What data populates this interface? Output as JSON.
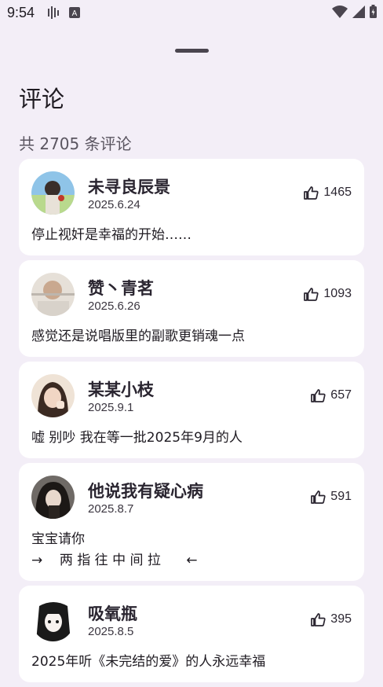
{
  "status_bar": {
    "time": "9:54"
  },
  "sheet": {
    "title": "评论",
    "count_text": "共 2705 条评论"
  },
  "comments": [
    {
      "name": "未寻良辰景",
      "date": "2025.6.24",
      "likes": "1465",
      "text": "停止视奸是幸福的开始……"
    },
    {
      "name": "赞丶青茗",
      "date": "2025.6.26",
      "likes": "1093",
      "text": "感觉还是说唱版里的副歌更销魂一点"
    },
    {
      "name": "某某小枝",
      "date": "2025.9.1",
      "likes": "657",
      "text": "嘘 别吵 我在等一批2025年9月的人"
    },
    {
      "name": "他说我有疑心病",
      "date": "2025.8.7",
      "likes": "591",
      "text": "宝宝请你\n→    两 指 往 中 间 拉      ←"
    },
    {
      "name": "吸氧瓶",
      "date": "2025.8.5",
      "likes": "395",
      "text": "2025年听《未完结的爱》的人永远幸福"
    }
  ],
  "icons": {
    "like": "thumb-up-icon",
    "wifi": "wifi-icon",
    "signal": "signal-icon",
    "battery": "battery-icon"
  }
}
